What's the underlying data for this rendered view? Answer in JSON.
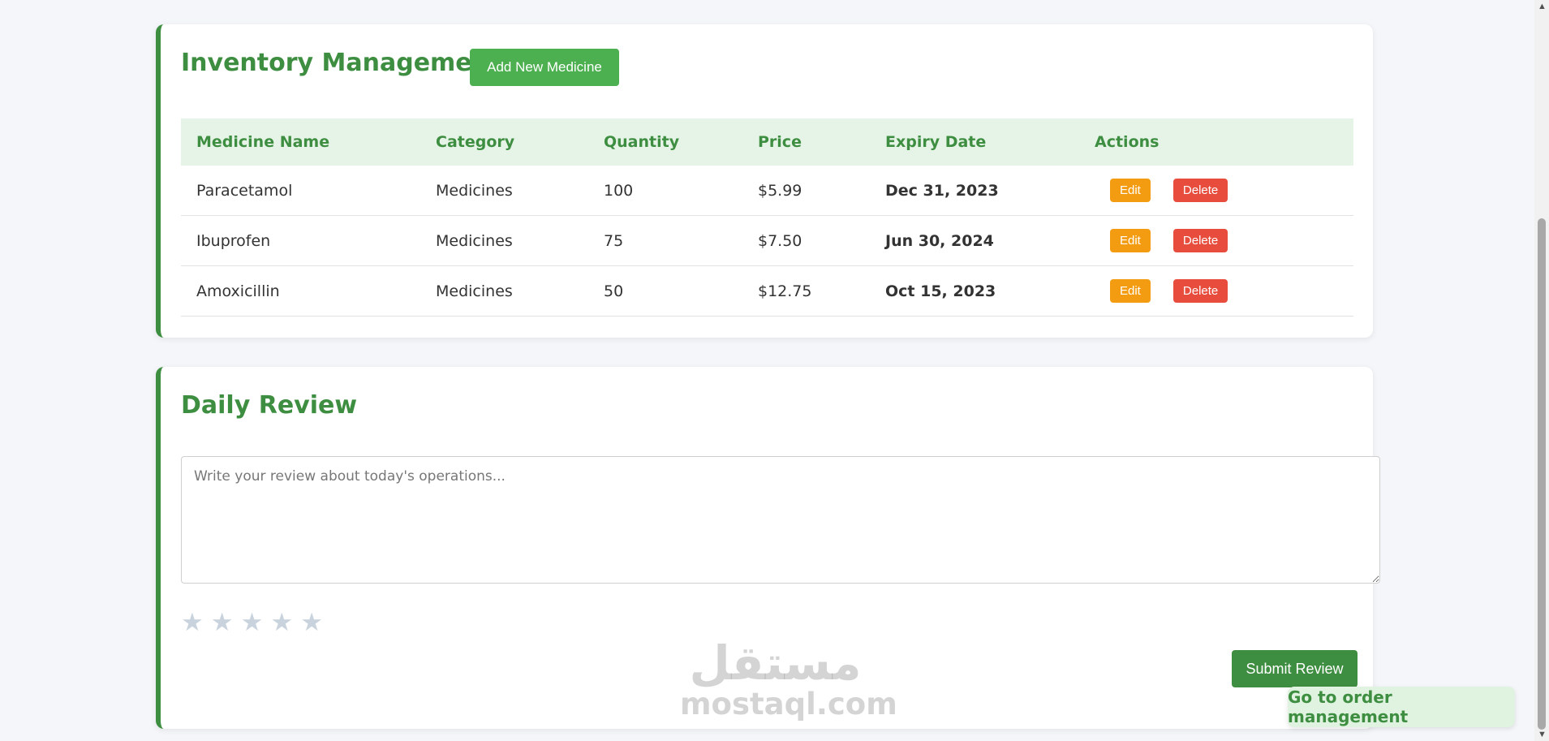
{
  "inventory": {
    "title": "Inventory Management",
    "add_button_label": "Add New Medicine",
    "columns": [
      "Medicine Name",
      "Category",
      "Quantity",
      "Price",
      "Expiry Date",
      "Actions"
    ],
    "rows": [
      {
        "name": "Paracetamol",
        "category": "Medicines",
        "quantity": "100",
        "price": "$5.99",
        "expiry": "Dec 31, 2023"
      },
      {
        "name": "Ibuprofen",
        "category": "Medicines",
        "quantity": "75",
        "price": "$7.50",
        "expiry": "Jun 30, 2024"
      },
      {
        "name": "Amoxicillin",
        "category": "Medicines",
        "quantity": "50",
        "price": "$12.75",
        "expiry": "Oct 15, 2023"
      }
    ],
    "edit_label": "Edit",
    "delete_label": "Delete"
  },
  "review": {
    "title": "Daily Review",
    "placeholder": "Write your review about today's operations...",
    "value": "",
    "rating": 0,
    "max_rating": 5,
    "submit_label": "Submit Review"
  },
  "footer": {
    "order_link_label": "Go to order management"
  },
  "watermark": {
    "logo_text": "مستقل",
    "site": "mostaql.com"
  },
  "colors": {
    "accent": "#3e8e41",
    "add_button": "#4caf50",
    "edit": "#f39c12",
    "delete": "#e74c3c",
    "expiry": "#e53935",
    "header_bg": "#e6f4e7",
    "star_empty": "#c9d3dd"
  },
  "icons": {
    "star": "star-icon",
    "scroll_up": "scroll-up-arrow-icon",
    "scroll_down": "scroll-down-arrow-icon"
  }
}
